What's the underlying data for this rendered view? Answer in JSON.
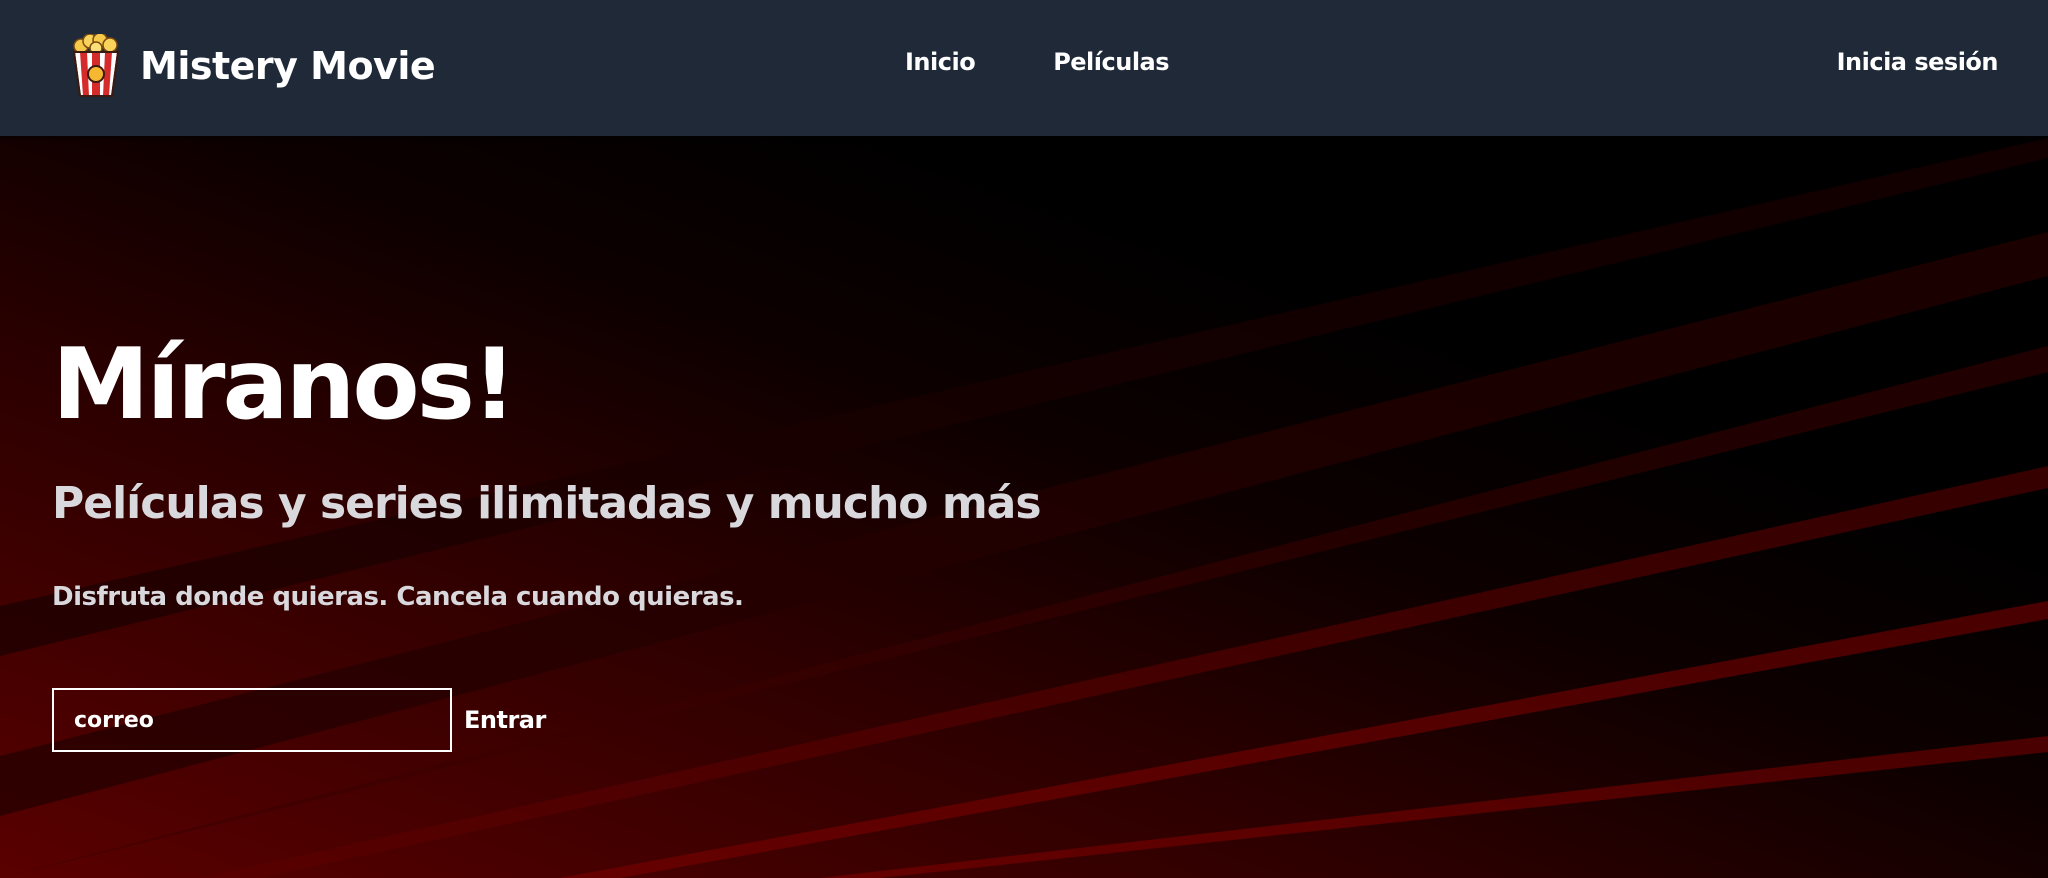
{
  "navbar": {
    "brand_name": "Mistery Movie",
    "logo_icon": "popcorn-icon",
    "links": [
      {
        "label": "Inicio"
      },
      {
        "label": "Películas"
      }
    ],
    "login_label": "Inicia sesión",
    "background_color": "#1f2937"
  },
  "hero": {
    "title": "Míranos!",
    "subtitle": "Películas y series ilimitadas y mucho más",
    "text": "Disfruta donde quieras. Cancela cuando quieras.",
    "email_placeholder": "correo",
    "submit_label": "Entrar",
    "accent_color": "#8b0000"
  }
}
